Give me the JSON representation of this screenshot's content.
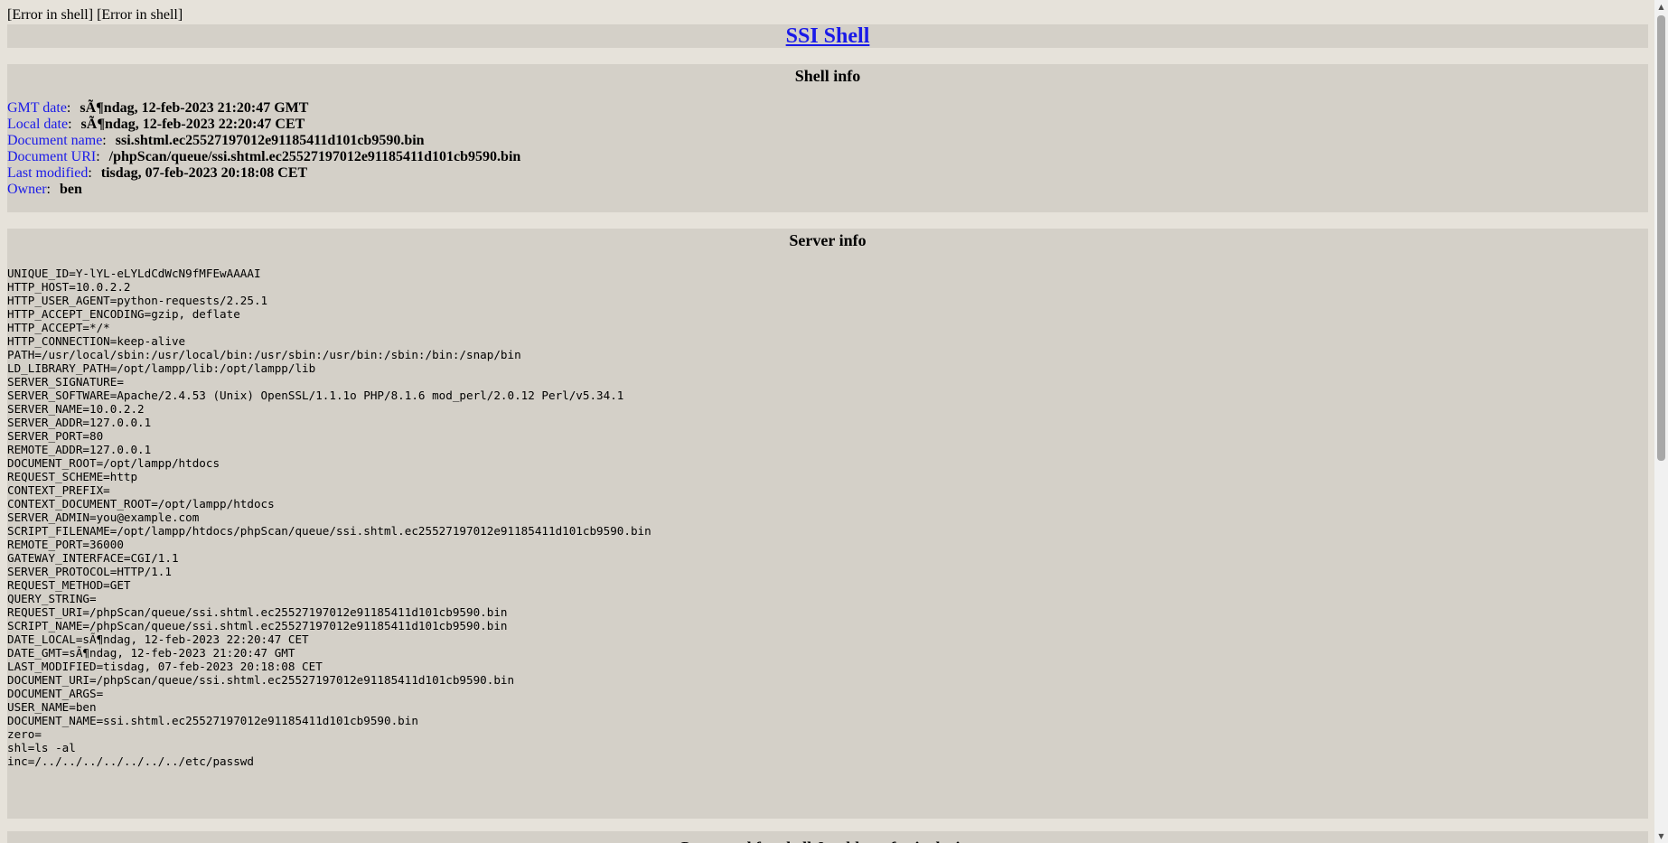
{
  "errors": "[Error in shell] [Error in shell]",
  "title": "SSI Shell",
  "shell_info": {
    "heading": "Shell info",
    "rows": [
      {
        "label": "GMT date",
        "value": "sÃ¶ndag, 12-feb-2023 21:20:47 GMT"
      },
      {
        "label": "Local date",
        "value": "sÃ¶ndag, 12-feb-2023 22:20:47 CET"
      },
      {
        "label": "Document name",
        "value": "ssi.shtml.ec25527197012e91185411d101cb9590.bin"
      },
      {
        "label": "Document URI",
        "value": "/phpScan/queue/ssi.shtml.ec25527197012e91185411d101cb9590.bin"
      },
      {
        "label": "Last modified",
        "value": "tisdag, 07-feb-2023 20:18:08 CET"
      },
      {
        "label": "Owner",
        "value": "ben"
      }
    ]
  },
  "server_info": {
    "heading": "Server info",
    "env": [
      "UNIQUE_ID=Y-lYL-eLYLdCdWcN9fMFEwAAAAI",
      "HTTP_HOST=10.0.2.2",
      "HTTP_USER_AGENT=python-requests/2.25.1",
      "HTTP_ACCEPT_ENCODING=gzip, deflate",
      "HTTP_ACCEPT=*/*",
      "HTTP_CONNECTION=keep-alive",
      "PATH=/usr/local/sbin:/usr/local/bin:/usr/sbin:/usr/bin:/sbin:/bin:/snap/bin",
      "LD_LIBRARY_PATH=/opt/lampp/lib:/opt/lampp/lib",
      "SERVER_SIGNATURE=",
      "SERVER_SOFTWARE=Apache/2.4.53 (Unix) OpenSSL/1.1.1o PHP/8.1.6 mod_perl/2.0.12 Perl/v5.34.1",
      "SERVER_NAME=10.0.2.2",
      "SERVER_ADDR=127.0.0.1",
      "SERVER_PORT=80",
      "REMOTE_ADDR=127.0.0.1",
      "DOCUMENT_ROOT=/opt/lampp/htdocs",
      "REQUEST_SCHEME=http",
      "CONTEXT_PREFIX=",
      "CONTEXT_DOCUMENT_ROOT=/opt/lampp/htdocs",
      "SERVER_ADMIN=you@example.com",
      "SCRIPT_FILENAME=/opt/lampp/htdocs/phpScan/queue/ssi.shtml.ec25527197012e91185411d101cb9590.bin",
      "REMOTE_PORT=36000",
      "GATEWAY_INTERFACE=CGI/1.1",
      "SERVER_PROTOCOL=HTTP/1.1",
      "REQUEST_METHOD=GET",
      "QUERY_STRING=",
      "REQUEST_URI=/phpScan/queue/ssi.shtml.ec25527197012e91185411d101cb9590.bin",
      "SCRIPT_NAME=/phpScan/queue/ssi.shtml.ec25527197012e91185411d101cb9590.bin",
      "DATE_LOCAL=sÃ¶ndag, 12-feb-2023 22:20:47 CET",
      "DATE_GMT=sÃ¶ndag, 12-feb-2023 21:20:47 GMT",
      "LAST_MODIFIED=tisdag, 07-feb-2023 20:18:08 CET",
      "DOCUMENT_URI=/phpScan/queue/ssi.shtml.ec25527197012e91185411d101cb9590.bin",
      "DOCUMENT_ARGS=",
      "USER_NAME=ben",
      "DOCUMENT_NAME=ssi.shtml.ec25527197012e91185411d101cb9590.bin",
      "zero=",
      "shl=ls -al",
      "inc=/../../../../../../../etc/passwd"
    ]
  },
  "command": {
    "heading": "Command for shell & address for inclusion"
  },
  "scrollbar": {
    "up_icon": "triangle-up-icon",
    "down_icon": "triangle-down-icon"
  }
}
